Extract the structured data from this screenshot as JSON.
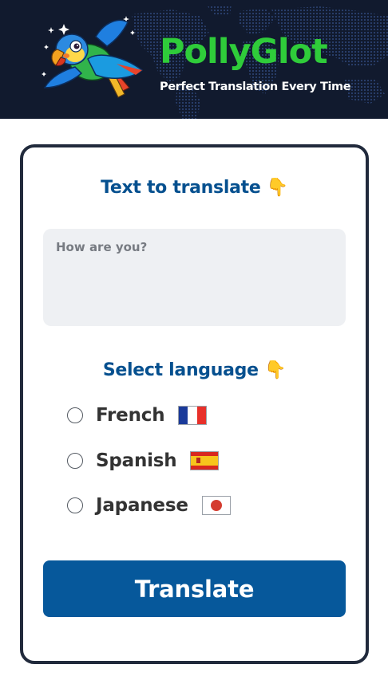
{
  "header": {
    "brand_title": "PollyGlot",
    "brand_tagline": "Perfect Translation Every Time",
    "logo_icon": "parrot-icon"
  },
  "translate_section": {
    "heading": "Text to translate",
    "heading_emoji": "👇",
    "input_placeholder": "How are you?",
    "input_value": ""
  },
  "language_section": {
    "heading": "Select language",
    "heading_emoji": "👇",
    "options": [
      {
        "label": "French",
        "flag_icon": "france-flag-icon",
        "selected": false
      },
      {
        "label": "Spanish",
        "flag_icon": "spain-flag-icon",
        "selected": false
      },
      {
        "label": "Japanese",
        "flag_icon": "japan-flag-icon",
        "selected": false
      }
    ]
  },
  "actions": {
    "translate_label": "Translate"
  },
  "colors": {
    "header_bg": "#111a2e",
    "brand_green": "#2fcc3a",
    "heading_blue": "#06508f",
    "button_blue": "#06589b",
    "card_border": "#212a3c",
    "input_bg": "#eef0f3"
  }
}
